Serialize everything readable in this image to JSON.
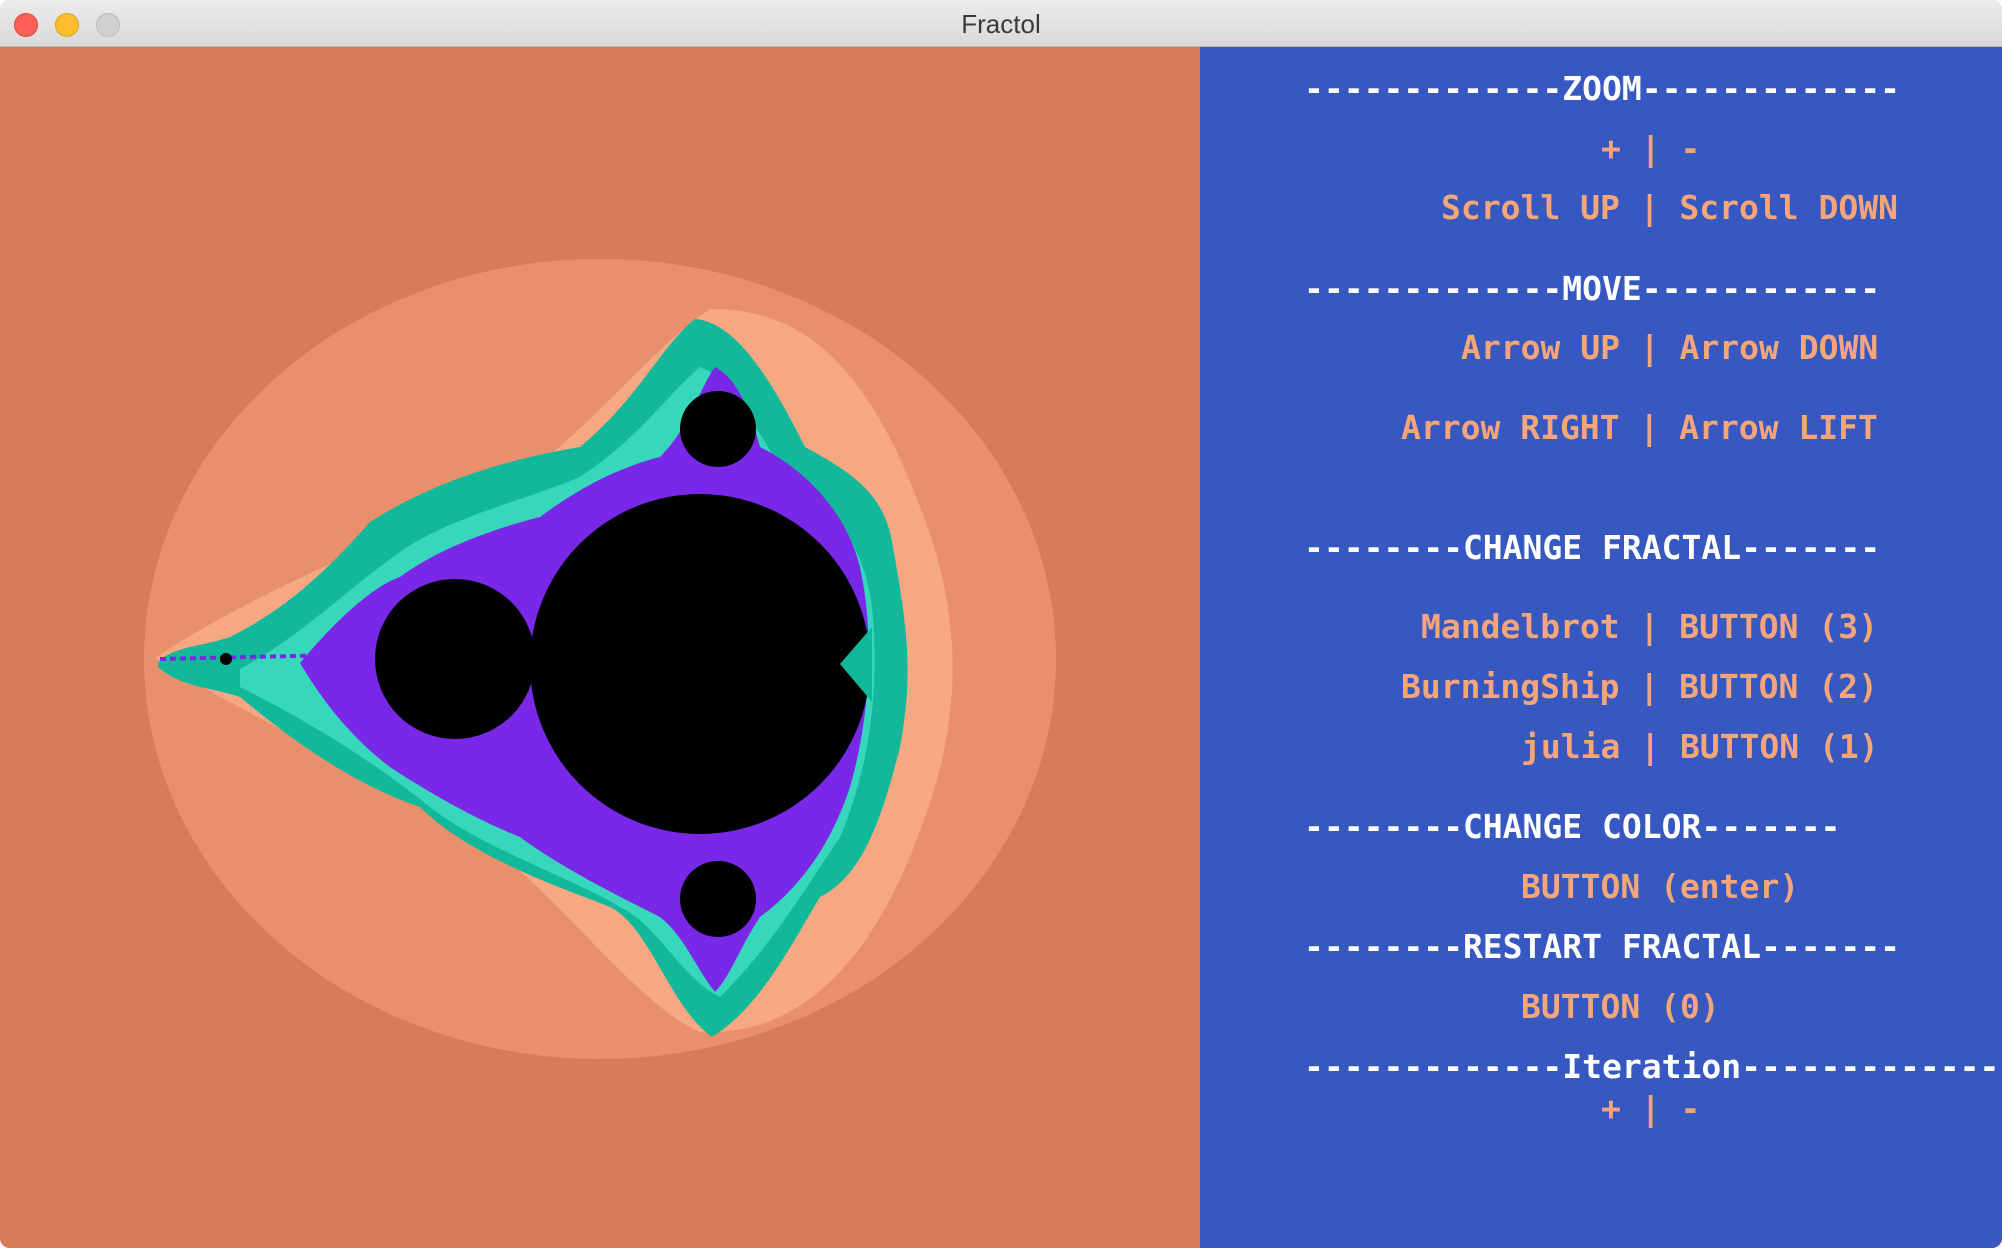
{
  "window": {
    "title": "Fractol",
    "fractal_colors": {
      "background": "#d57d5b",
      "outer_halo": "#e8906c",
      "inner_halo": "#f7a882",
      "teal": "#12b89a",
      "teal_light": "#37d7bc",
      "purple": "#7a28e8",
      "set": "#000000"
    }
  },
  "panel": {
    "bg_color": "#3658c0",
    "zoom_header": "-------------ZOOM-------------",
    "zoom_keys": "+ | -",
    "zoom_scroll": "Scroll UP | Scroll DOWN",
    "move_header": "-------------MOVE------------",
    "move_vertical": "Arrow UP | Arrow DOWN",
    "move_horizontal": "Arrow RIGHT | Arrow LIFT",
    "change_fractal_header": "--------CHANGE FRACTAL-------",
    "mandelbrot": "Mandelbrot | BUTTON (3)",
    "burningship": "BurningShip | BUTTON (2)",
    "julia": "julia | BUTTON (1)",
    "change_color_header": "--------CHANGE COLOR-------",
    "change_color_key": "BUTTON (enter)",
    "restart_header": "--------RESTART FRACTAL-------",
    "restart_key": "BUTTON (0)",
    "iteration_header": "-------------Iteration-------------",
    "iteration_keys": "+ | -"
  }
}
